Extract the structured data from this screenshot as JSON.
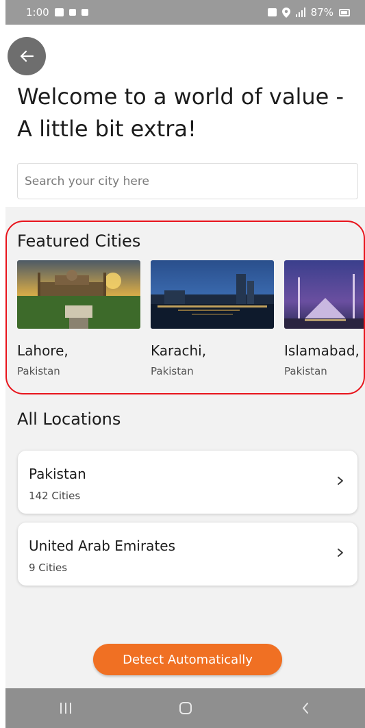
{
  "status_bar": {
    "time": "1:00",
    "battery": "87%"
  },
  "header": {
    "back_icon": "arrow-left-icon",
    "title": "Welcome to a world of value - A little bit extra!"
  },
  "search": {
    "placeholder": "Search your city here"
  },
  "featured": {
    "title": "Featured Cities",
    "cities": [
      {
        "name": "Lahore,",
        "country": "Pakistan"
      },
      {
        "name": "Karachi,",
        "country": "Pakistan"
      },
      {
        "name": "Islamabad,",
        "country": "Pakistan"
      }
    ]
  },
  "all_locations": {
    "title": "All Locations",
    "items": [
      {
        "name": "Pakistan",
        "count": "142 Cities"
      },
      {
        "name": "United Arab Emirates",
        "count": "9 Cities"
      }
    ]
  },
  "detect_button": {
    "label": "Detect Automatically"
  },
  "colors": {
    "accent": "#f07023",
    "highlight_border": "#e8141c",
    "background": "#f2f2f2"
  }
}
